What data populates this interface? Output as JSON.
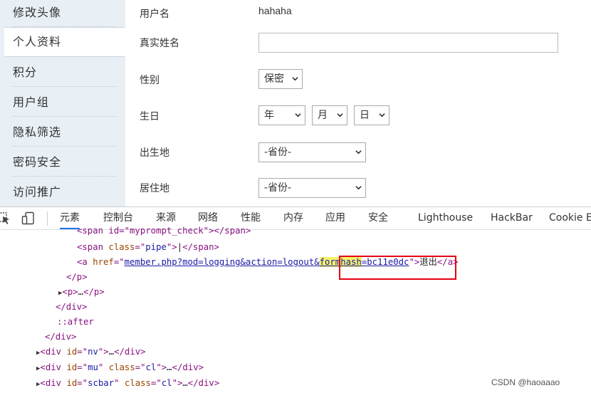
{
  "sidebar": {
    "items": [
      {
        "label": "修改头像"
      },
      {
        "label": "个人资料"
      },
      {
        "label": "积分"
      },
      {
        "label": "用户组"
      },
      {
        "label": "隐私筛选"
      },
      {
        "label": "密码安全"
      },
      {
        "label": "访问推广"
      }
    ]
  },
  "form": {
    "username_label": "用户名",
    "username_value": "hahaha",
    "realname_label": "真实姓名",
    "gender_label": "性别",
    "gender_value": "保密",
    "birthday_label": "生日",
    "birth_year": "年",
    "birth_month": "月",
    "birth_day": "日",
    "birthplace_label": "出生地",
    "birthplace_value": "-省份-",
    "residence_label": "居住地",
    "residence_value": "-省份-"
  },
  "devtools": {
    "tabs": [
      "元素",
      "控制台",
      "来源",
      "网络",
      "性能",
      "内存",
      "应用",
      "安全",
      "Lighthouse",
      "HackBar",
      "Cookie Ec"
    ],
    "code": {
      "l0": "<span id=\"myprompt_check\"></span>",
      "l1_a": "<span ",
      "l1_b": "class",
      "l1_c": "=\"",
      "l1_d": "pipe",
      "l1_e": "\">",
      "l1_f": "|",
      "l1_g": "</span>",
      "l2_a": "<a ",
      "l2_b": "href",
      "l2_c": "=\"",
      "l2_d": "member.php?mod=logging&action=logout",
      "l2_e": "&",
      "l2_f": "formhash",
      "l2_g": "=bc11e0dc",
      "l2_h": "\">",
      "l2_i": "退出",
      "l2_j": "</a>",
      "l3": "</p>",
      "l4_a": "<p>",
      "l4_b": "…",
      "l4_c": "</p>",
      "l5": "</div>",
      "l6": "::after",
      "l7": "</div>",
      "l8_a": "<div ",
      "l8_b": "id",
      "l8_c": "=\"",
      "l8_d": "nv",
      "l8_e": "\">",
      "l8_f": "…",
      "l8_g": "</div>",
      "l9_a": "<div ",
      "l9_b": "id",
      "l9_c": "=\"",
      "l9_d": "mu",
      "l9_e": "\" ",
      "l9_f": "class",
      "l9_g": "=\"",
      "l9_h": "cl",
      "l9_i": "\">",
      "l9_j": "…",
      "l9_k": "</div>",
      "l10_a": "<div ",
      "l10_b": "id",
      "l10_c": "=\"",
      "l10_d": "scbar",
      "l10_e": "\" ",
      "l10_f": "class",
      "l10_g": "=\"",
      "l10_h": "cl",
      "l10_i": "\">",
      "l10_j": "…",
      "l10_k": "</div>"
    }
  },
  "watermark": "CSDN @haoaaao",
  "colors": {
    "sidebar_bg": "#e8eff5",
    "tag": "#881280",
    "attr": "#994500",
    "attr_value": "#1a1aa6",
    "highlight": "#f6f26a",
    "annotation_box": "#e60012",
    "active_tab": "#1a73e8"
  }
}
